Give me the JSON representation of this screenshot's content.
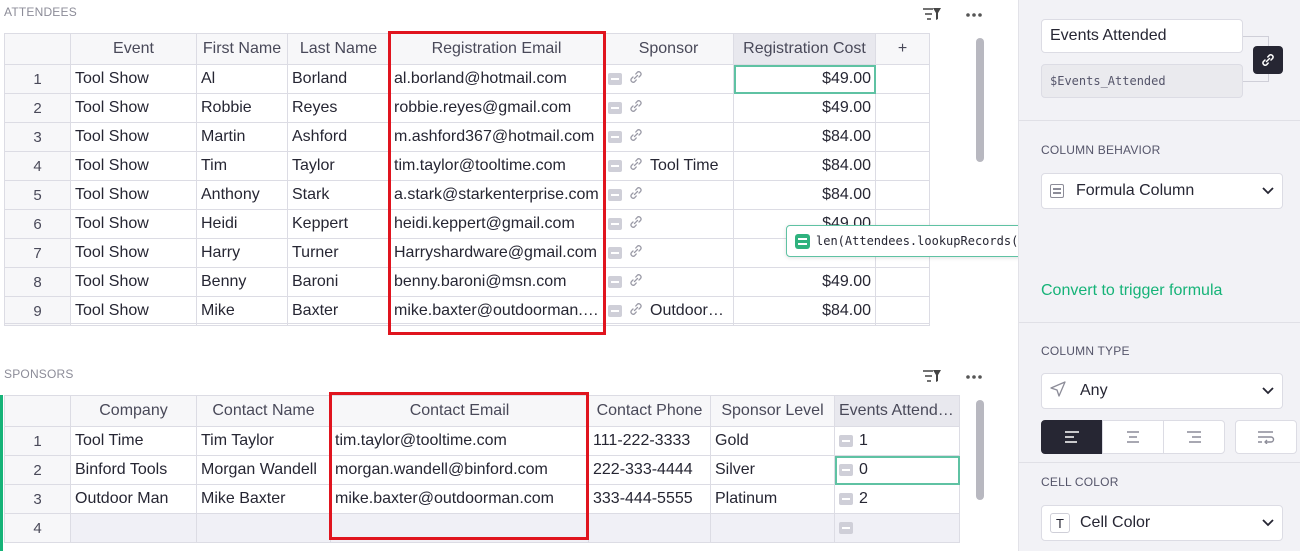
{
  "attendees": {
    "title": "ATTENDEES",
    "columns": [
      "Event",
      "First Name",
      "Last Name",
      "Registration Email",
      "Sponsor",
      "Registration Cost",
      "+"
    ],
    "rows": [
      {
        "n": "1",
        "event": "Tool Show",
        "first": "Al",
        "last": "Borland",
        "email": "al.borland@hotmail.com",
        "sponsor": "",
        "cost": "$49.00"
      },
      {
        "n": "2",
        "event": "Tool Show",
        "first": "Robbie",
        "last": "Reyes",
        "email": "robbie.reyes@gmail.com",
        "sponsor": "",
        "cost": "$49.00"
      },
      {
        "n": "3",
        "event": "Tool Show",
        "first": "Martin",
        "last": "Ashford",
        "email": "m.ashford367@hotmail.com",
        "sponsor": "",
        "cost": "$84.00"
      },
      {
        "n": "4",
        "event": "Tool Show",
        "first": "Tim",
        "last": "Taylor",
        "email": "tim.taylor@tooltime.com",
        "sponsor": "Tool Time",
        "cost": "$84.00"
      },
      {
        "n": "5",
        "event": "Tool Show",
        "first": "Anthony",
        "last": "Stark",
        "email": "a.stark@starkenterprise.com",
        "sponsor": "",
        "cost": "$84.00"
      },
      {
        "n": "6",
        "event": "Tool Show",
        "first": "Heidi",
        "last": "Keppert",
        "email": "heidi.keppert@gmail.com",
        "sponsor": "",
        "cost": "$49.00"
      },
      {
        "n": "7",
        "event": "Tool Show",
        "first": "Harry",
        "last": "Turner",
        "email": "Harryshardware@gmail.com",
        "sponsor": "",
        "cost": ""
      },
      {
        "n": "8",
        "event": "Tool Show",
        "first": "Benny",
        "last": "Baroni",
        "email": "benny.baroni@msn.com",
        "sponsor": "",
        "cost": "$49.00"
      },
      {
        "n": "9",
        "event": "Tool Show",
        "first": "Mike",
        "last": "Baxter",
        "email": "mike.baxter@outdoorman.…",
        "sponsor": "Outdoor…",
        "cost": "$84.00"
      }
    ]
  },
  "sponsors": {
    "title": "SPONSORS",
    "columns": [
      "Company",
      "Contact Name",
      "Contact Email",
      "Contact Phone",
      "Sponsor Level",
      "Events Attended"
    ],
    "rows": [
      {
        "n": "1",
        "company": "Tool Time",
        "name": "Tim Taylor",
        "email": "tim.taylor@tooltime.com",
        "phone": "111-222-3333",
        "level": "Gold",
        "events": "1"
      },
      {
        "n": "2",
        "company": "Binford Tools",
        "name": "Morgan Wandell",
        "email": "morgan.wandell@binford.com",
        "phone": "222-333-4444",
        "level": "Silver",
        "events": "0"
      },
      {
        "n": "3",
        "company": "Outdoor Man",
        "name": "Mike Baxter",
        "email": "mike.baxter@outdoorman.com",
        "phone": "333-444-5555",
        "level": "Platinum",
        "events": "2"
      },
      {
        "n": "4",
        "company": "",
        "name": "",
        "email": "",
        "phone": "",
        "level": "",
        "events": ""
      }
    ]
  },
  "formula": "len(Attendees.lookupRecords(Registration_Email=$Contact_Email))",
  "panel": {
    "column_label": "Events Attended",
    "column_id": "$Events_Attended",
    "behavior_title": "COLUMN BEHAVIOR",
    "behavior_value": "Formula Column",
    "convert_link": "Convert to trigger formula",
    "type_title": "COLUMN TYPE",
    "type_value": "Any",
    "cell_color_title": "CELL COLOR",
    "cell_color_value": "Cell Color",
    "cell_color_prefix": "T"
  },
  "colors": {
    "accent": "#16b378",
    "highlight": "#e0141e",
    "selection": "#5fc2a3"
  }
}
